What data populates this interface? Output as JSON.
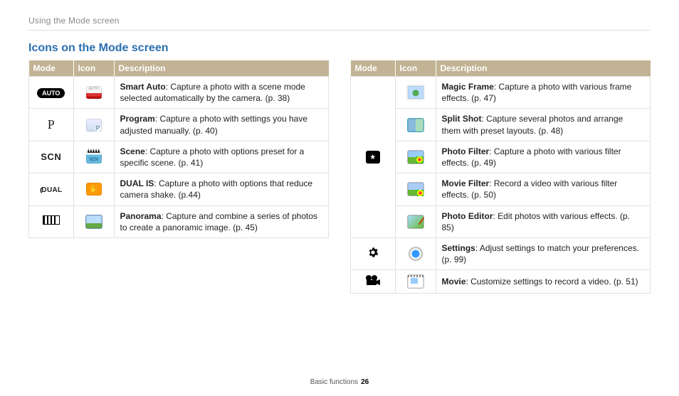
{
  "header": {
    "breadcrumb": "Using the Mode screen",
    "title": "Icons on the Mode screen"
  },
  "columns": {
    "mode": "Mode",
    "icon": "Icon",
    "description": "Description"
  },
  "left": [
    {
      "mode": "AUTO",
      "term": "Smart Auto",
      "desc": ": Capture a photo with a scene mode selected automatically by the camera. (p. 38)"
    },
    {
      "mode": "P",
      "term": "Program",
      "desc": ": Capture a photo with settings you have adjusted manually. (p. 40)"
    },
    {
      "mode": "SCN",
      "term": "Scene",
      "desc": ": Capture a photo with options preset for a specific scene. (p. 41)"
    },
    {
      "mode": "DUAL",
      "term": "DUAL IS",
      "desc": ": Capture a photo with options that reduce camera shake. (p.44)"
    },
    {
      "mode": "panorama",
      "term": "Panorama",
      "desc": ": Capture and combine a series of photos to create a panoramic image. (p. 45)"
    }
  ],
  "right": [
    {
      "mode": "magic",
      "term": "Magic Frame",
      "desc": ": Capture a photo with various frame effects. (p. 47)"
    },
    {
      "mode": "magic",
      "term": "Split Shot",
      "desc": ": Capture several photos and arrange them with preset layouts. (p. 48)"
    },
    {
      "mode": "magic",
      "term": "Photo Filter",
      "desc": ": Capture a photo with various filter effects. (p. 49)"
    },
    {
      "mode": "magic",
      "term": "Movie Filter",
      "desc": ": Record a video with various filter effects. (p. 50)"
    },
    {
      "mode": "magic",
      "term": "Photo Editor",
      "desc": ": Edit photos with various effects. (p. 85)"
    },
    {
      "mode": "settings",
      "term": "Settings",
      "desc": ": Adjust settings to match your preferences. (p. 99)"
    },
    {
      "mode": "movie",
      "term": "Movie",
      "desc": ": Customize settings to record a video. (p. 51)"
    }
  ],
  "footer": {
    "section": "Basic functions",
    "page": "26"
  }
}
